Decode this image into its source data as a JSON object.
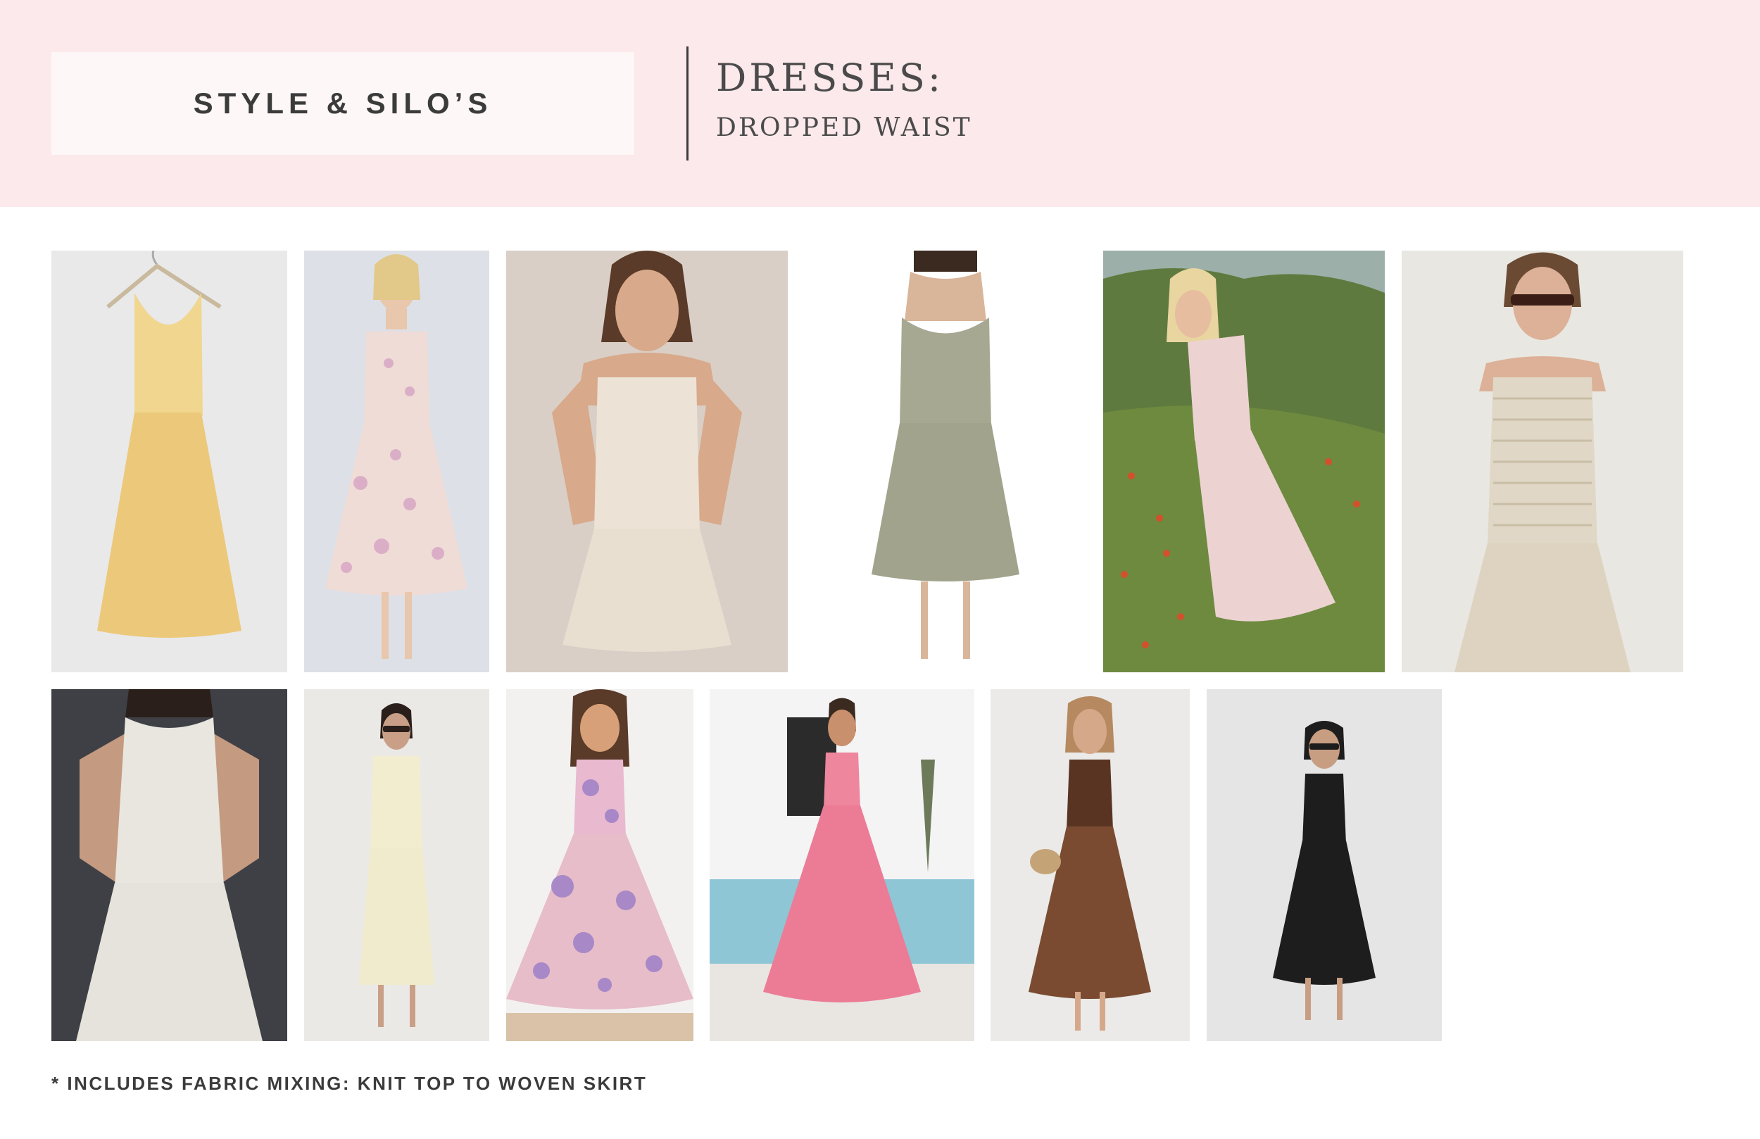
{
  "header": {
    "brand": "STYLE & SILO’S",
    "title": "DRESSES:",
    "subtitle": "DROPPED WAIST"
  },
  "footnote": "* INCLUDES FABRIC MIXING: KNIT TOP TO WOVEN SKIRT",
  "colors": {
    "header_bg": "#fce9eb",
    "brand_box_bg": "#fdf7f7",
    "text": "#3b3b3b"
  },
  "products": [
    {
      "id": "yellow-tank-midi-dress",
      "dress": "#ecc97a",
      "bg": "#e9e9ea"
    },
    {
      "id": "floral-corset-midi-dress",
      "dress": "#efdcd6",
      "bg": "#dde0e6"
    },
    {
      "id": "ivory-mini-dress",
      "dress": "#ece3d6",
      "bg": "#d9cfc6"
    },
    {
      "id": "sage-corset-midi-dress",
      "dress": "#a7a892",
      "bg": "#ffffff"
    },
    {
      "id": "blush-strapless-dress",
      "dress": "#ecd3d2",
      "bg": "#5f7a3e"
    },
    {
      "id": "smocked-linen-dress",
      "dress": "#e0d7c6",
      "bg": "#e9e7e2"
    },
    {
      "id": "white-textured-dress",
      "dress": "#e8e6df",
      "bg": "#3f4046"
    },
    {
      "id": "cream-sleeveless-dress",
      "dress": "#f2edcf",
      "bg": "#ebe9e6"
    },
    {
      "id": "purple-floral-maxi-dress",
      "dress": "#d9a7c6",
      "bg": "#f3f1f0"
    },
    {
      "id": "pink-tiered-maxi-dress",
      "dress": "#ec7c96",
      "bg": "#b3d7e0"
    },
    {
      "id": "brown-knit-midi-dress",
      "dress": "#7a4b31",
      "bg": "#ebeae8"
    },
    {
      "id": "black-scoop-midi-dress",
      "dress": "#1d1d1d",
      "bg": "#e5e5e5"
    }
  ]
}
